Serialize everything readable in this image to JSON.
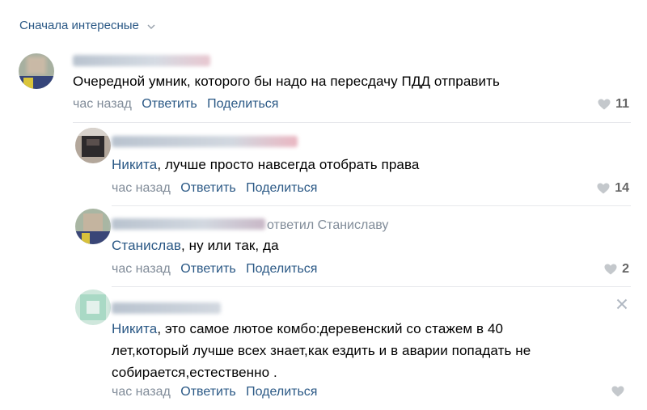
{
  "sort_label": "Сначала интересные",
  "comments": [
    {
      "text": "Очередной умник, которого бы надо на пересдачу ПДД отправить",
      "time": "час назад",
      "reply_label": "Ответить",
      "share_label": "Поделиться",
      "likes": "11"
    },
    {
      "mention": "Никита",
      "text": ", лучше просто навсегда отобрать права",
      "time": "час назад",
      "reply_label": "Ответить",
      "share_label": "Поделиться",
      "likes": "14"
    },
    {
      "replied_to": "ответил Станиславу",
      "mention": "Станислав",
      "text": ", ну или так, да",
      "time": "час назад",
      "reply_label": "Ответить",
      "share_label": "Поделиться",
      "likes": "2"
    },
    {
      "mention": "Никита",
      "text_line1": ", это самое лютое комбо:деревенский со стажем в 40",
      "text_line2": "лет,который лучше всех знает,как ездить и в аварии попадать не",
      "text_line3": "собирается,естественно .",
      "time": "час назад",
      "reply_label": "Ответить",
      "share_label": "Поделиться",
      "likes": ""
    }
  ],
  "icons": {
    "heart": "heart-icon",
    "close": "close-icon",
    "chevron": "chevron-down-icon"
  }
}
